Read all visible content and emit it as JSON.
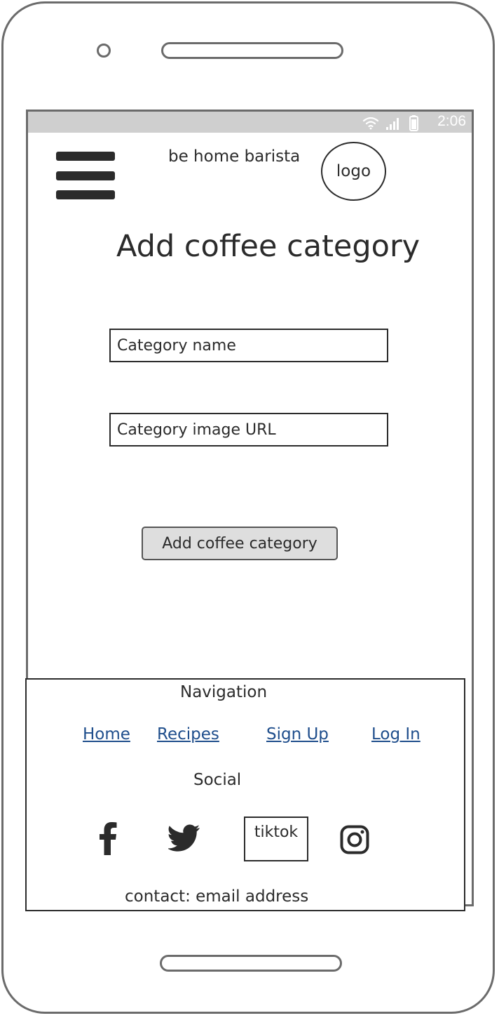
{
  "status_bar": {
    "time": "2:06",
    "icons": [
      "wifi-icon",
      "signal-icon",
      "battery-icon"
    ]
  },
  "header": {
    "brand": "be home barista",
    "logo_text": "logo",
    "menu_icon": "hamburger-menu-icon"
  },
  "main": {
    "title": "Add coffee category",
    "category_name_placeholder": "Category name",
    "category_image_placeholder": "Category image URL",
    "submit_label": "Add coffee category"
  },
  "footer": {
    "navigation_heading": "Navigation",
    "nav_links": [
      "Home",
      "Recipes",
      "Sign Up",
      "Log In"
    ],
    "social_heading": "Social",
    "social_icons": [
      "facebook-icon",
      "twitter-icon",
      "tiktok-placeholder",
      "instagram-icon"
    ],
    "tiktok_label": "tiktok",
    "contact": "contact: email address"
  },
  "colors": {
    "frame": "#6b6b6b",
    "status_bar": "#cfcfcf",
    "text": "#2b2b2b",
    "link": "#1f4e8c",
    "button_bg": "#dedede"
  }
}
